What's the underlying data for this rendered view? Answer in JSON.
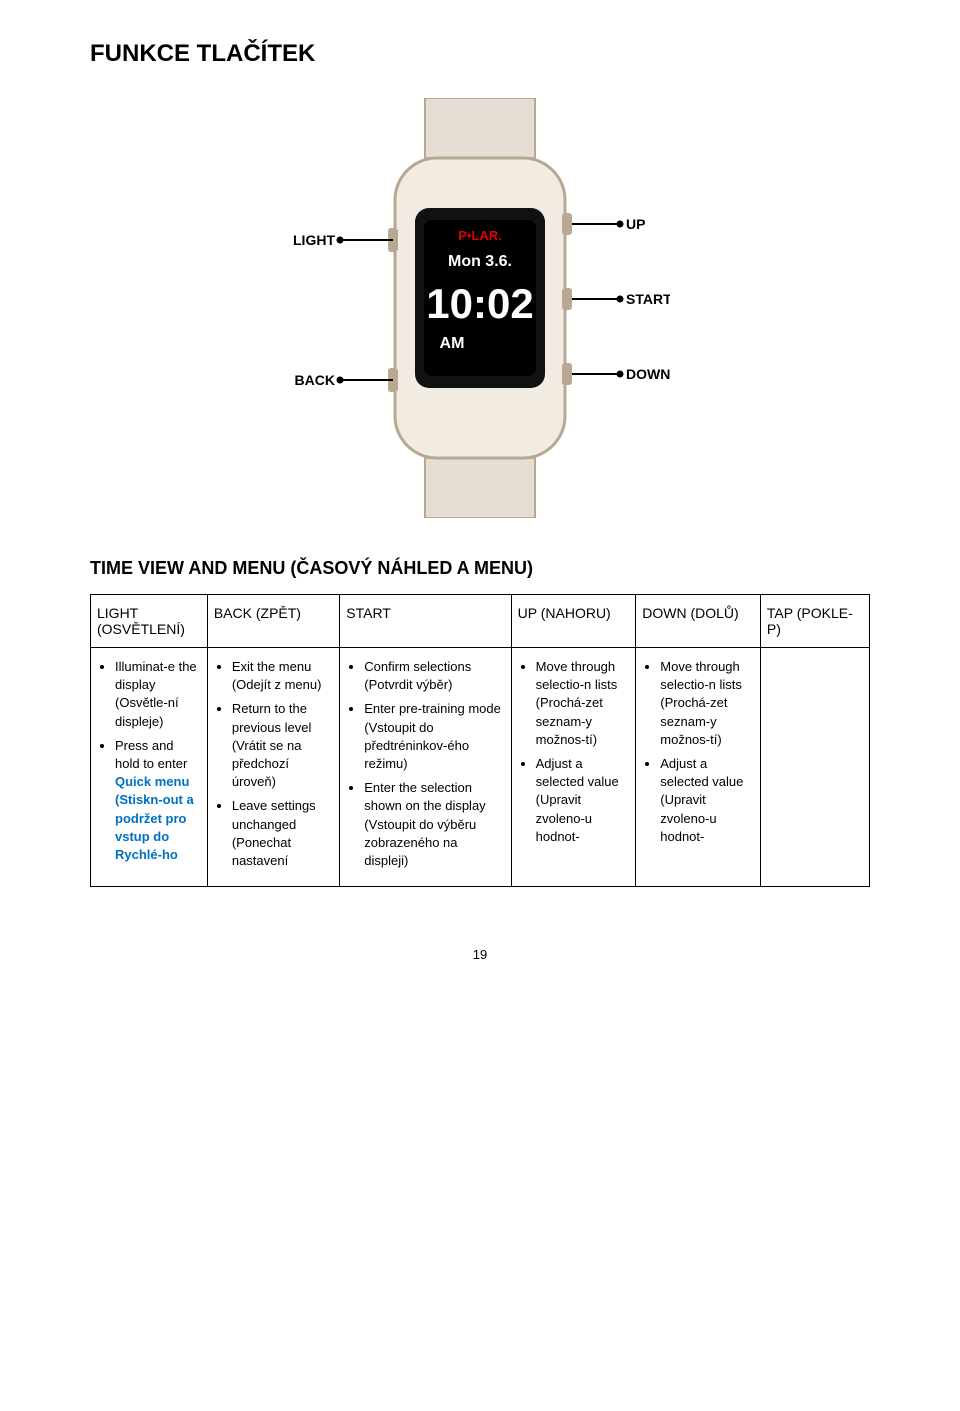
{
  "heading": "FUNKCE TLAČÍTEK",
  "diagram": {
    "left_top": "LIGHT",
    "left_bottom": "BACK",
    "right_top": "UP",
    "right_mid": "START",
    "right_bottom": "DOWN",
    "brand": "P•LAR.",
    "day": "Mon 3.6.",
    "time": "10:02",
    "ampm": "AM"
  },
  "section_title": "TIME VIEW AND MENU (ČASOVÝ NÁHLED A MENU)",
  "headers": {
    "c0": "LIGHT (OSVĚTLENÍ)",
    "c1": "BACK (ZPĚT)",
    "c2": "START",
    "c3": "UP (NAHORU)",
    "c4": "DOWN (DOLŮ)",
    "c5": "TAP (POKLE-P)"
  },
  "col0": {
    "i0a": "Illuminat-e the display (Osvětle-ní displeje)",
    "i1a": "Press and hold to enter ",
    "i1b": "Quick menu (Stiskn-out a podržet pro vstup do Rychlé-ho"
  },
  "col1": {
    "i0": "Exit the menu (Odejít z menu)",
    "i1": "Return to the previous level (Vrátit se na předchozí úroveň)",
    "i2": "Leave settings unchanged (Ponechat nastavení"
  },
  "col2": {
    "i0": "Confirm selections (Potvrdit výběr)",
    "i1": "Enter pre-training mode (Vstoupit do předtréninkov-ého režimu)",
    "i2": "Enter the selection shown on the display (Vstoupit do výběru zobrazeného na displeji)"
  },
  "col3": {
    "i0": "Move through selectio-n lists (Prochá-zet seznam-y možnos-tí)",
    "i1": "Adjust a selected value (Upravit zvoleno-u hodnot-"
  },
  "col4": {
    "i0": "Move through selectio-n lists (Prochá-zet seznam-y možnos-tí)",
    "i1": "Adjust a selected value (Upravit zvoleno-u hodnot-"
  },
  "page": "19"
}
